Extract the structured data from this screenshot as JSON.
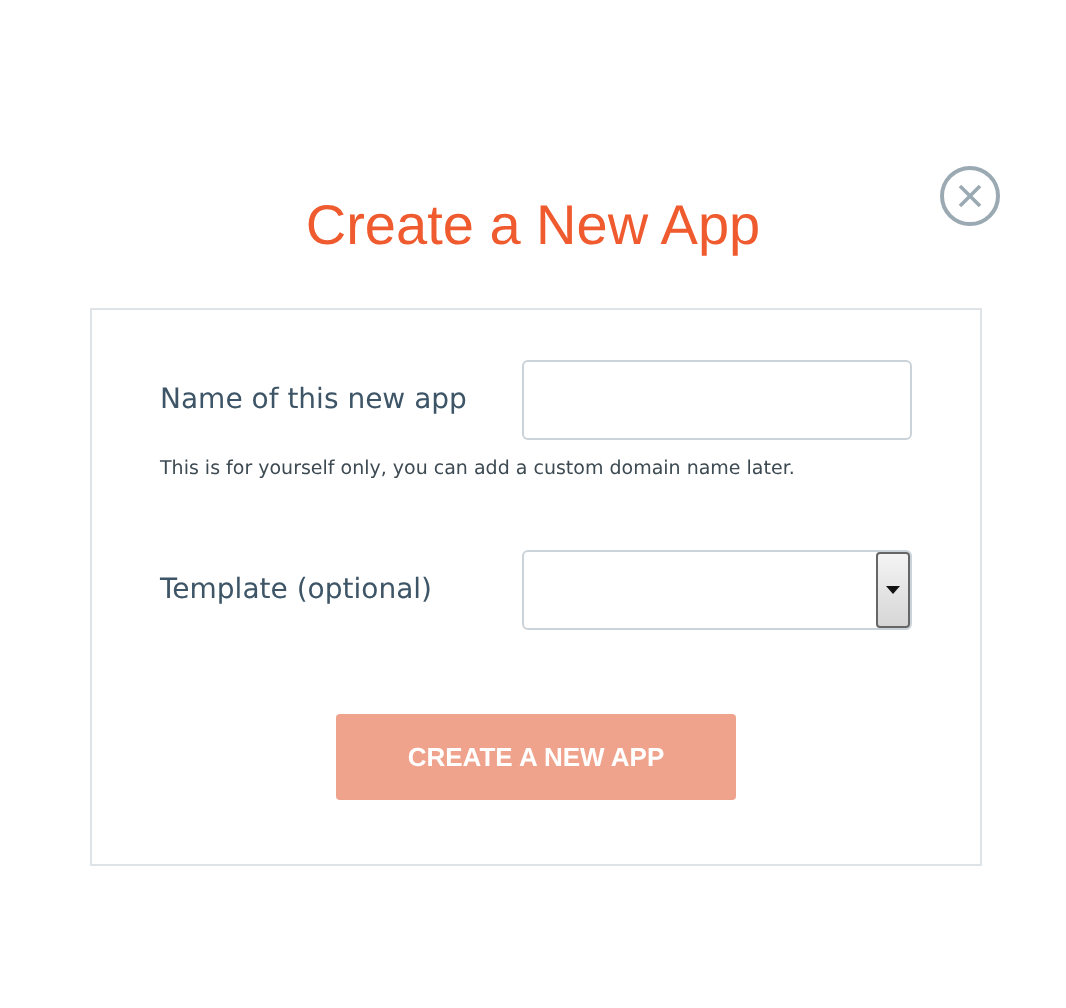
{
  "title": "Create a New App",
  "form": {
    "name_field": {
      "label": "Name of this new app",
      "hint": "This is for yourself only, you can add a custom domain name later."
    },
    "template_field": {
      "label": "Template (optional)"
    },
    "submit": {
      "label": "CREATE A NEW APP",
      "disabled": true
    }
  }
}
